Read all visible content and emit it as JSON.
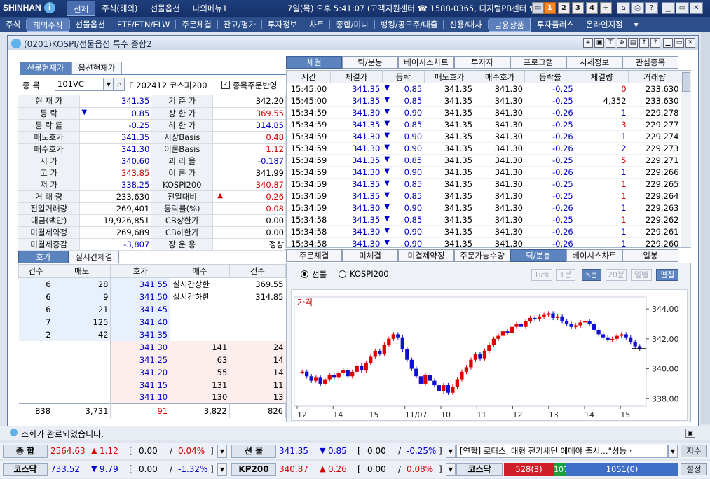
{
  "top": {
    "brand": "SHINHAN",
    "menus": [
      "전체",
      "주식(해외)",
      "선물옵션",
      "나의메뉴1"
    ],
    "datetime": "7일(목) 오후 5:41:07",
    "support": "(고객지원센터 ☎ 1588-0365, 디지털PB센터 ☎ 02",
    "nums": [
      "1",
      "2",
      "3",
      "4",
      "+"
    ]
  },
  "menubar": [
    "주식",
    "해외주식",
    "선물옵션",
    "ETF/ETN/ELW",
    "주문체결",
    "잔고/평가",
    "투자정보",
    "차트",
    "종합/미니",
    "뱅킹/공모주/대출",
    "신용/대차",
    "금융상품",
    "투자플러스",
    "온라인지점"
  ],
  "window": {
    "title": "(0201)KOSPI/선물옵션 특수 종합2"
  },
  "left": {
    "tabs": [
      "선물현재가",
      "옵션현재가"
    ],
    "code_label": "종  목",
    "code": "101VC",
    "name": "F 202412 코스피200",
    "check_label": "종목주문반영",
    "rows": [
      {
        "l1": "현 재 가",
        "v1": "341.35",
        "c1": "blue",
        "a1": "",
        "l2": "기 준 가",
        "v2": "342.20",
        "c2": "blk"
      },
      {
        "l1": "등    락",
        "v1": "0.85",
        "c1": "blue",
        "a1": "▼",
        "l2": "상 한 가",
        "v2": "369.55",
        "c2": "red"
      },
      {
        "l1": "등 락 률",
        "v1": "-0.25",
        "c1": "blue",
        "a1": "",
        "l2": "하 한 가",
        "v2": "314.85",
        "c2": "blue"
      },
      {
        "l1": "매도호가",
        "v1": "341.35",
        "c1": "blue",
        "a1": "",
        "l2": "시장Basis",
        "v2": "0.48",
        "c2": "red"
      },
      {
        "l1": "매수호가",
        "v1": "341.30",
        "c1": "blue",
        "a1": "",
        "l2": "이론Basis",
        "v2": "1.12",
        "c2": "red"
      },
      {
        "l1": "시    가",
        "v1": "340.60",
        "c1": "blue",
        "a1": "",
        "l2": "괴 리 율",
        "v2": "-0.187",
        "c2": "blue"
      },
      {
        "l1": "고    가",
        "v1": "343.85",
        "c1": "red",
        "a1": "",
        "l2": "이 론 가",
        "v2": "341.99",
        "c2": "blk"
      },
      {
        "l1": "저    가",
        "v1": "338.25",
        "c1": "blue",
        "a1": "",
        "l2": "KOSPI200",
        "v2": "340.87",
        "c2": "red"
      },
      {
        "l1": "거 래 량",
        "v1": "233,630",
        "c1": "blk",
        "a1": "",
        "l2": "전일대비",
        "v2": "0.26",
        "c2": "red",
        "a2": "▲"
      },
      {
        "l1": "전일거래량",
        "v1": "269,401",
        "c1": "blk",
        "a1": "",
        "l2": "등락률(%)",
        "v2": "0.08",
        "c2": "red"
      },
      {
        "l1": "대금(백만)",
        "v1": "19,926,851",
        "c1": "blk",
        "a1": "",
        "l2": "CB상한가",
        "v2": "0.00",
        "c2": "blk"
      },
      {
        "l1": "미결제약정",
        "v1": "269,689",
        "c1": "blk",
        "a1": "",
        "l2": "CB하한가",
        "v2": "0.00",
        "c2": "blk"
      },
      {
        "l1": "미결제증감",
        "v1": "-3,807",
        "c1": "blue",
        "a1": "",
        "l2": "장 운 용",
        "v2": "정상",
        "c2": "blk"
      }
    ]
  },
  "orderbook": {
    "tabs": [
      "호가",
      "실시간체결"
    ],
    "headers": [
      "건수",
      "매도",
      "호가",
      "매수",
      "건수"
    ],
    "asks": [
      {
        "cnt": "6",
        "qty": "28",
        "p": "341.55"
      },
      {
        "cnt": "6",
        "qty": "9",
        "p": "341.50"
      },
      {
        "cnt": "6",
        "qty": "21",
        "p": "341.45"
      },
      {
        "cnt": "7",
        "qty": "125",
        "p": "341.40"
      },
      {
        "cnt": "2",
        "qty": "42",
        "p": "341.35"
      }
    ],
    "bids": [
      {
        "p": "341.30",
        "qty": "141",
        "cnt": "24"
      },
      {
        "p": "341.25",
        "qty": "63",
        "cnt": "14"
      },
      {
        "p": "341.20",
        "qty": "55",
        "cnt": "14"
      },
      {
        "p": "341.15",
        "qty": "131",
        "cnt": "11"
      },
      {
        "p": "341.10",
        "qty": "130",
        "cnt": "13"
      }
    ],
    "upper_label": "실시간상한",
    "upper": "369.55",
    "lower_label": "실시간하한",
    "lower": "314.85",
    "tot": [
      "838",
      "3,731",
      "91",
      "3,822",
      "826"
    ]
  },
  "trades": {
    "tabs": [
      "체결",
      "틱/분봉",
      "베이시스차트",
      "투자자",
      "프로그램",
      "시세정보",
      "관심종목"
    ],
    "headers": [
      "시간",
      "체결가",
      "등락",
      "매도호가",
      "매수호가",
      "등락률",
      "체결량",
      "거래량"
    ],
    "rows": [
      [
        "15:45:00",
        "341.35",
        "0.85",
        "341.35",
        "341.30",
        "-0.25",
        "0",
        "233,630"
      ],
      [
        "15:45:00",
        "341.35",
        "0.85",
        "341.35",
        "341.30",
        "-0.25",
        "4,352",
        "233,630"
      ],
      [
        "15:34:59",
        "341.30",
        "0.90",
        "341.35",
        "341.30",
        "-0.26",
        "1",
        "229,278"
      ],
      [
        "15:34:59",
        "341.35",
        "0.85",
        "341.35",
        "341.30",
        "-0.25",
        "3",
        "229,277"
      ],
      [
        "15:34:59",
        "341.30",
        "0.90",
        "341.35",
        "341.30",
        "-0.26",
        "1",
        "229,274"
      ],
      [
        "15:34:59",
        "341.30",
        "0.90",
        "341.35",
        "341.30",
        "-0.26",
        "2",
        "229,273"
      ],
      [
        "15:34:59",
        "341.35",
        "0.85",
        "341.35",
        "341.30",
        "-0.25",
        "5",
        "229,271"
      ],
      [
        "15:34:59",
        "341.30",
        "0.90",
        "341.35",
        "341.30",
        "-0.26",
        "1",
        "229,266"
      ],
      [
        "15:34:59",
        "341.35",
        "0.85",
        "341.35",
        "341.30",
        "-0.25",
        "1",
        "229,265"
      ],
      [
        "15:34:59",
        "341.35",
        "0.85",
        "341.35",
        "341.30",
        "-0.25",
        "1",
        "229,264"
      ],
      [
        "15:34:59",
        "341.30",
        "0.90",
        "341.35",
        "341.30",
        "-0.26",
        "1",
        "229,263"
      ],
      [
        "15:34:58",
        "341.35",
        "0.85",
        "341.35",
        "341.30",
        "-0.25",
        "1",
        "229,262"
      ],
      [
        "15:34:58",
        "341.30",
        "0.90",
        "341.35",
        "341.30",
        "-0.26",
        "1",
        "229,261"
      ],
      [
        "15:34:58",
        "341.30",
        "0.90",
        "341.35",
        "341.30",
        "-0.26",
        "1",
        "229,260"
      ]
    ]
  },
  "chartpanel": {
    "tabs": [
      "주문체결",
      "미체결",
      "미결제약정",
      "주문가능수량",
      "틱/분봉",
      "베이시스차트",
      "일봉"
    ],
    "radio1": "선물",
    "radio2": "KOSPI200",
    "units": [
      "Tick",
      "1분",
      "5분",
      "20분",
      "일별"
    ],
    "edit": "편집",
    "label": "가격"
  },
  "chart_data": {
    "type": "candlestick",
    "title": "가격",
    "y_ticks": [
      "344.00",
      "342.00",
      "340.00",
      "338.00"
    ],
    "x_ticks": [
      "12",
      "14",
      "15",
      "11/07",
      "10",
      "11",
      "12",
      "13",
      "14",
      "15"
    ],
    "ylim": [
      337.5,
      344.8
    ],
    "last": 341.35
  },
  "status": "조회가 완료되었습니다.",
  "bottom": {
    "r1": [
      {
        "name": "종  합",
        "price": "2564.63",
        "dir": "▲",
        "chg": "1.12",
        "vol": "0.00",
        "pct": "0.04%"
      },
      {
        "name": "선  물",
        "price": "341.35",
        "dir": "▼",
        "chg": "0.85",
        "vol": "0.00",
        "pct": "-0.25%"
      }
    ],
    "r2": [
      {
        "name": "코스닥",
        "price": "733.52",
        "dir": "▼",
        "chg": "9.79",
        "vol": "0.00",
        "pct": "-1.32%"
      },
      {
        "name": "KP200",
        "price": "340.87",
        "dir": "▲",
        "chg": "0.26",
        "vol": "0.00",
        "pct": "0.08%"
      }
    ],
    "news": "[연합] 로터스, 대형 전기세단 에메야 출시…\"성능 ·",
    "kosdaq_label": "코스닥",
    "kosdaq_down": "528(3)",
    "kosdaq_flat": "107",
    "kosdaq_up": "1051(0)",
    "btn1": "지수",
    "btn2": "설정"
  }
}
